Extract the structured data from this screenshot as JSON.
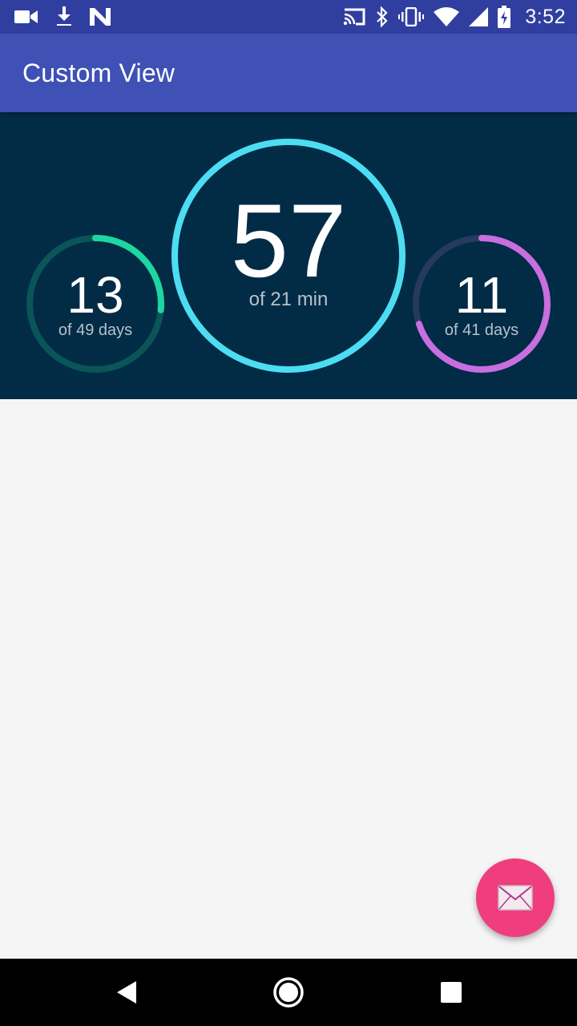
{
  "status_bar": {
    "time": "3:52",
    "left_icons": [
      "video-camera-icon",
      "download-icon",
      "n-logo-icon"
    ],
    "right_icons": [
      "cast-icon",
      "bluetooth-icon",
      "vibrate-icon",
      "wifi-icon",
      "cell-signal-icon",
      "battery-charging-icon"
    ]
  },
  "app_bar": {
    "title": "Custom View"
  },
  "gauges": {
    "left": {
      "value": "13",
      "label": "of 49 days",
      "fraction": 0.265,
      "color": "#1ED6A0",
      "track_color": "#0A5558"
    },
    "center": {
      "value": "57",
      "label": "of 21 min",
      "fraction": 1.0,
      "color": "#4DDDF2",
      "track_color": "#0A4A64"
    },
    "right": {
      "value": "11",
      "label": "of 41 days",
      "fraction": 0.7,
      "color": "#C86EE0",
      "track_color": "#263A5E"
    }
  },
  "fab": {
    "icon": "mail-icon",
    "color": "#F03D7E"
  },
  "nav_bar": {
    "buttons": [
      "back-icon",
      "home-icon",
      "recents-icon"
    ]
  },
  "colors": {
    "status_bar": "#303F9F",
    "app_bar": "#3F51B5",
    "dashboard_bg": "#022B45",
    "content_bg": "#F5F5F5"
  }
}
